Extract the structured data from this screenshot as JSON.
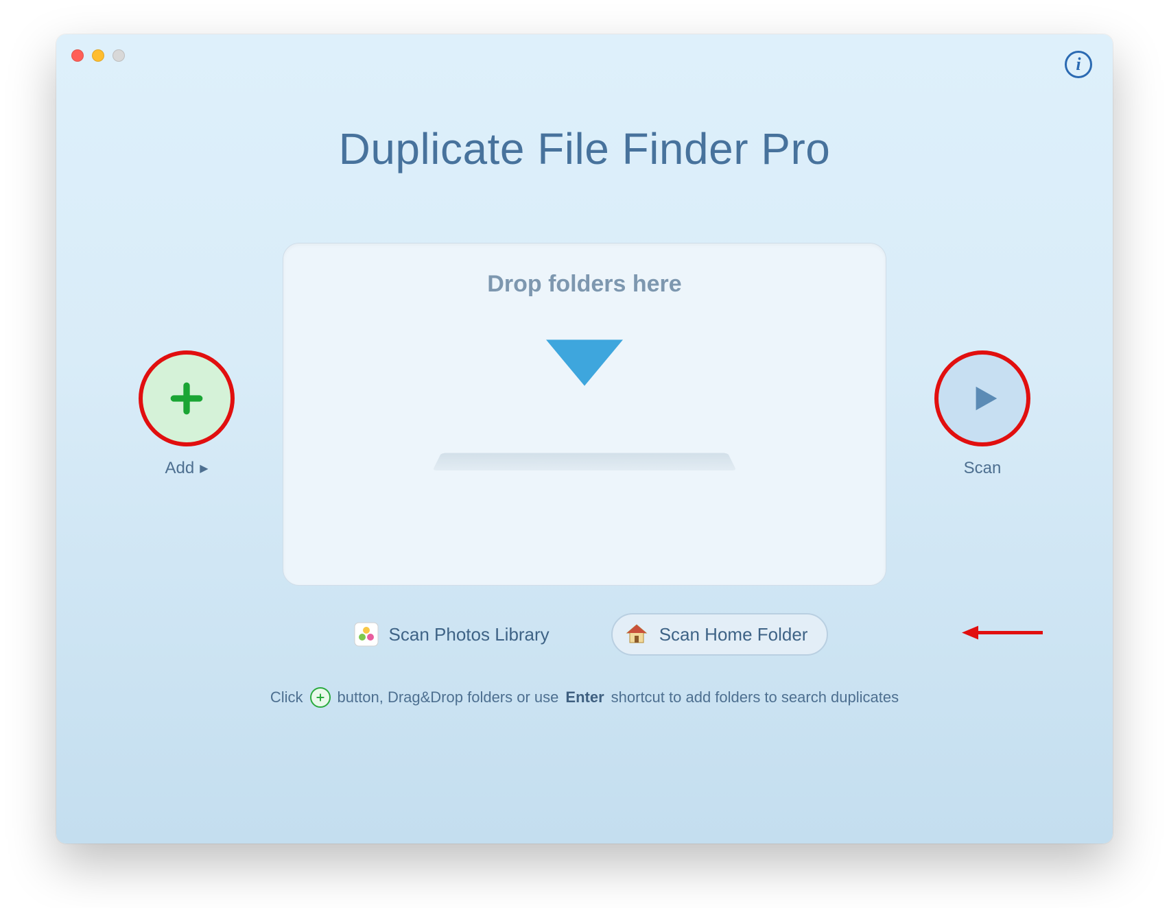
{
  "app_title": "Duplicate File Finder Pro",
  "drop_zone": {
    "title": "Drop folders here"
  },
  "add_button": {
    "label": "Add"
  },
  "scan_button": {
    "label": "Scan"
  },
  "shortcuts": {
    "photos": {
      "label": "Scan Photos Library"
    },
    "home": {
      "label": "Scan Home Folder"
    }
  },
  "hint": {
    "pre": "Click",
    "mid": "button, Drag&Drop folders or use",
    "key": "Enter",
    "post": "shortcut to add folders to search duplicates"
  },
  "annotations": {
    "add_highlight_color": "#e10f0f",
    "scan_highlight_color": "#e10f0f",
    "arrow_color": "#e10f0f"
  }
}
